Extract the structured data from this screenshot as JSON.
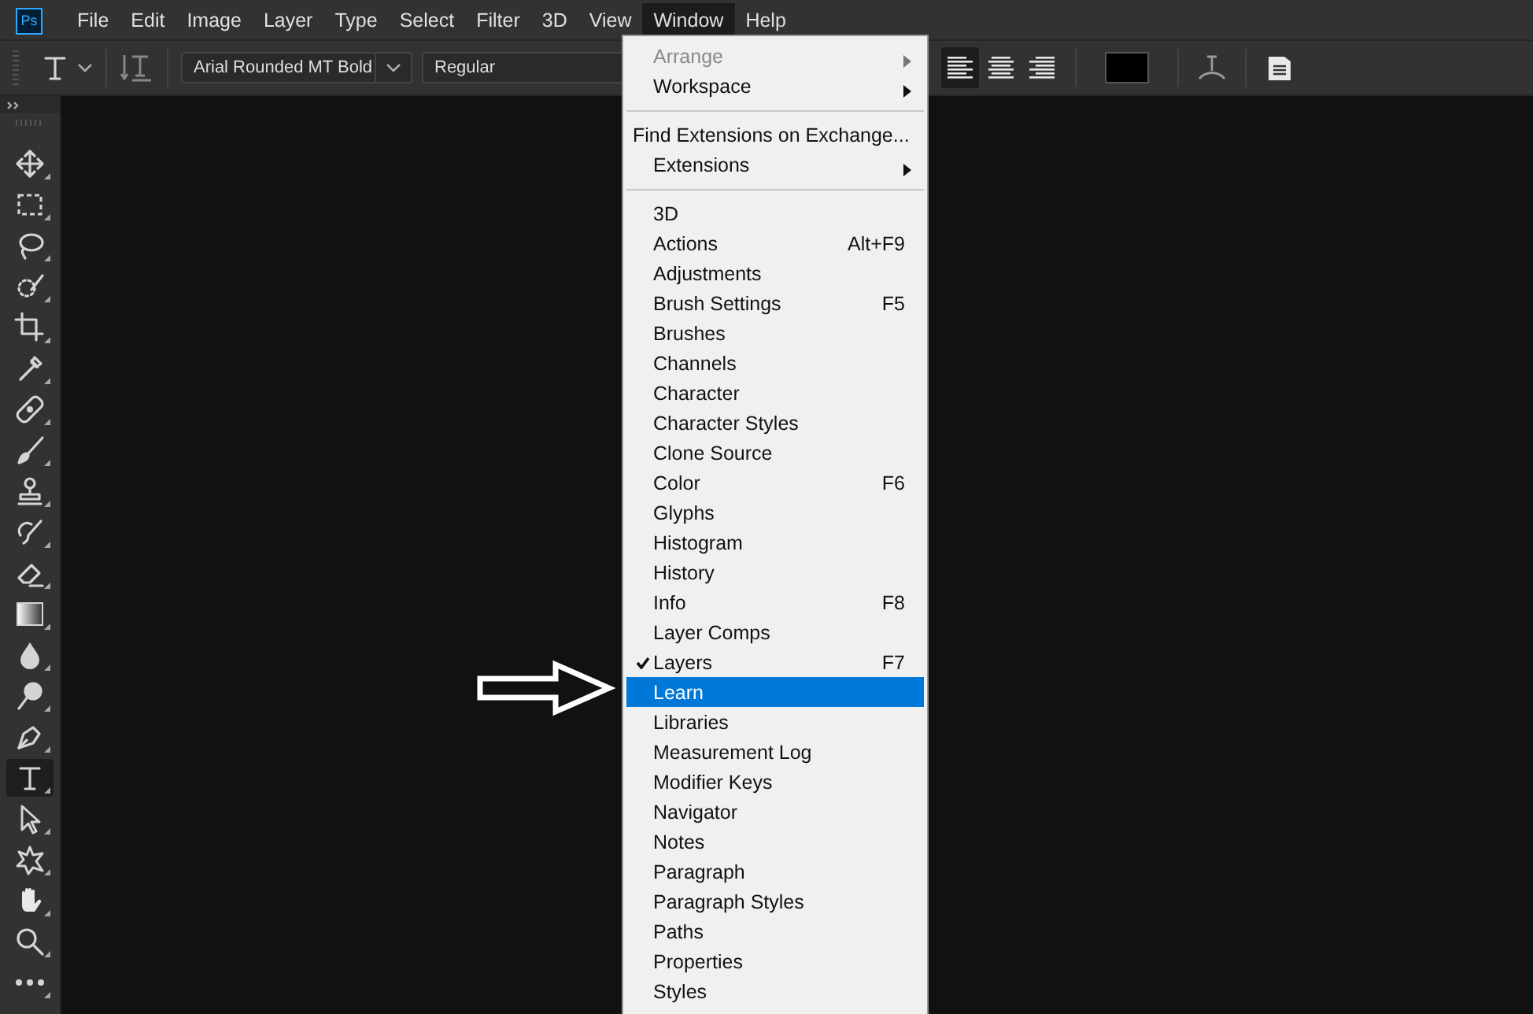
{
  "app_icon": {
    "label": "Ps"
  },
  "menubar": [
    {
      "label": "File",
      "selected": false
    },
    {
      "label": "Edit",
      "selected": false
    },
    {
      "label": "Image",
      "selected": false
    },
    {
      "label": "Layer",
      "selected": false
    },
    {
      "label": "Type",
      "selected": false
    },
    {
      "label": "Select",
      "selected": false
    },
    {
      "label": "Filter",
      "selected": false
    },
    {
      "label": "3D",
      "selected": false
    },
    {
      "label": "View",
      "selected": false
    },
    {
      "label": "Window",
      "selected": true
    },
    {
      "label": "Help",
      "selected": false
    }
  ],
  "options_bar": {
    "font_family": "Arial Rounded MT Bold",
    "font_style": "Regular",
    "align": [
      {
        "kind": "left",
        "selected": true
      },
      {
        "kind": "center",
        "selected": false
      },
      {
        "kind": "right",
        "selected": false
      }
    ]
  },
  "tools": [
    {
      "kind": "move",
      "selected": false
    },
    {
      "kind": "marquee",
      "selected": false
    },
    {
      "kind": "lasso",
      "selected": false
    },
    {
      "kind": "quickselect",
      "selected": false
    },
    {
      "kind": "crop",
      "selected": false
    },
    {
      "kind": "eyedropper",
      "selected": false
    },
    {
      "kind": "healing",
      "selected": false
    },
    {
      "kind": "brush",
      "selected": false
    },
    {
      "kind": "stamp",
      "selected": false
    },
    {
      "kind": "historybrush",
      "selected": false
    },
    {
      "kind": "eraser",
      "selected": false
    },
    {
      "kind": "gradient",
      "selected": false
    },
    {
      "kind": "blur",
      "selected": false
    },
    {
      "kind": "dodge",
      "selected": false
    },
    {
      "kind": "pen",
      "selected": false
    },
    {
      "kind": "type",
      "selected": true
    },
    {
      "kind": "pathselect",
      "selected": false
    },
    {
      "kind": "shape",
      "selected": false
    },
    {
      "kind": "hand",
      "selected": false
    },
    {
      "kind": "zoom",
      "selected": false
    },
    {
      "kind": "more",
      "selected": false
    }
  ],
  "window_menu": {
    "sections": [
      [
        {
          "label": "Arrange",
          "disabled": true,
          "submenu": true,
          "checked": false,
          "selected": false
        },
        {
          "label": "Workspace",
          "disabled": false,
          "submenu": true,
          "checked": false,
          "selected": false
        }
      ],
      [
        {
          "label": "Find Extensions on Exchange...",
          "disabled": false,
          "submenu": false,
          "checked": false,
          "selected": false
        },
        {
          "label": "Extensions",
          "disabled": false,
          "submenu": true,
          "checked": false,
          "selected": false
        }
      ],
      [
        {
          "label": "3D",
          "disabled": false,
          "submenu": false,
          "checked": false,
          "selected": false
        },
        {
          "label": "Actions",
          "shortcut": "Alt+F9",
          "disabled": false,
          "submenu": false,
          "checked": false,
          "selected": false
        },
        {
          "label": "Adjustments",
          "disabled": false,
          "submenu": false,
          "checked": false,
          "selected": false
        },
        {
          "label": "Brush Settings",
          "shortcut": "F5",
          "disabled": false,
          "submenu": false,
          "checked": false,
          "selected": false
        },
        {
          "label": "Brushes",
          "disabled": false,
          "submenu": false,
          "checked": false,
          "selected": false
        },
        {
          "label": "Channels",
          "disabled": false,
          "submenu": false,
          "checked": false,
          "selected": false
        },
        {
          "label": "Character",
          "disabled": false,
          "submenu": false,
          "checked": false,
          "selected": false
        },
        {
          "label": "Character Styles",
          "disabled": false,
          "submenu": false,
          "checked": false,
          "selected": false
        },
        {
          "label": "Clone Source",
          "disabled": false,
          "submenu": false,
          "checked": false,
          "selected": false
        },
        {
          "label": "Color",
          "shortcut": "F6",
          "disabled": false,
          "submenu": false,
          "checked": false,
          "selected": false
        },
        {
          "label": "Glyphs",
          "disabled": false,
          "submenu": false,
          "checked": false,
          "selected": false
        },
        {
          "label": "Histogram",
          "disabled": false,
          "submenu": false,
          "checked": false,
          "selected": false
        },
        {
          "label": "History",
          "disabled": false,
          "submenu": false,
          "checked": false,
          "selected": false
        },
        {
          "label": "Info",
          "shortcut": "F8",
          "disabled": false,
          "submenu": false,
          "checked": false,
          "selected": false
        },
        {
          "label": "Layer Comps",
          "disabled": false,
          "submenu": false,
          "checked": false,
          "selected": false
        },
        {
          "label": "Layers",
          "shortcut": "F7",
          "disabled": false,
          "submenu": false,
          "checked": true,
          "selected": false
        },
        {
          "label": "Learn",
          "disabled": false,
          "submenu": false,
          "checked": false,
          "selected": true
        },
        {
          "label": "Libraries",
          "disabled": false,
          "submenu": false,
          "checked": false,
          "selected": false
        },
        {
          "label": "Measurement Log",
          "disabled": false,
          "submenu": false,
          "checked": false,
          "selected": false
        },
        {
          "label": "Modifier Keys",
          "disabled": false,
          "submenu": false,
          "checked": false,
          "selected": false
        },
        {
          "label": "Navigator",
          "disabled": false,
          "submenu": false,
          "checked": false,
          "selected": false
        },
        {
          "label": "Notes",
          "disabled": false,
          "submenu": false,
          "checked": false,
          "selected": false
        },
        {
          "label": "Paragraph",
          "disabled": false,
          "submenu": false,
          "checked": false,
          "selected": false
        },
        {
          "label": "Paragraph Styles",
          "disabled": false,
          "submenu": false,
          "checked": false,
          "selected": false
        },
        {
          "label": "Paths",
          "disabled": false,
          "submenu": false,
          "checked": false,
          "selected": false
        },
        {
          "label": "Properties",
          "disabled": false,
          "submenu": false,
          "checked": false,
          "selected": false
        },
        {
          "label": "Styles",
          "disabled": false,
          "submenu": false,
          "checked": false,
          "selected": false
        }
      ]
    ]
  }
}
